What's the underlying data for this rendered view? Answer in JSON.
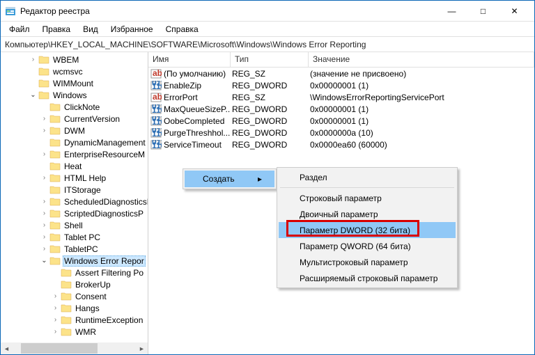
{
  "window": {
    "title": "Редактор реестра",
    "minimize": "—",
    "maximize": "□",
    "close": "✕"
  },
  "menu": {
    "file": "Файл",
    "edit": "Правка",
    "view": "Вид",
    "favorites": "Избранное",
    "help": "Справка"
  },
  "address": {
    "label": "Компьютер",
    "path": "\\HKEY_LOCAL_MACHINE\\SOFTWARE\\Microsoft\\Windows\\Windows Error Reporting"
  },
  "columns": {
    "name": "Имя",
    "type": "Тип",
    "value": "Значение"
  },
  "tree": [
    {
      "pad": 40,
      "toggle": ">",
      "label": "WBEM"
    },
    {
      "pad": 40,
      "toggle": "",
      "label": "wcmsvc"
    },
    {
      "pad": 40,
      "toggle": "",
      "label": "WIMMount"
    },
    {
      "pad": 40,
      "toggle": "v",
      "label": "Windows"
    },
    {
      "pad": 56,
      "toggle": "",
      "label": "ClickNote"
    },
    {
      "pad": 56,
      "toggle": ">",
      "label": "CurrentVersion"
    },
    {
      "pad": 56,
      "toggle": ">",
      "label": "DWM"
    },
    {
      "pad": 56,
      "toggle": "",
      "label": "DynamicManagement"
    },
    {
      "pad": 56,
      "toggle": ">",
      "label": "EnterpriseResourceM"
    },
    {
      "pad": 56,
      "toggle": "",
      "label": "Heat"
    },
    {
      "pad": 56,
      "toggle": ">",
      "label": "HTML Help"
    },
    {
      "pad": 56,
      "toggle": "",
      "label": "ITStorage"
    },
    {
      "pad": 56,
      "toggle": ">",
      "label": "ScheduledDiagnosticsP"
    },
    {
      "pad": 56,
      "toggle": ">",
      "label": "ScriptedDiagnosticsP"
    },
    {
      "pad": 56,
      "toggle": ">",
      "label": "Shell"
    },
    {
      "pad": 56,
      "toggle": ">",
      "label": "Tablet PC"
    },
    {
      "pad": 56,
      "toggle": ">",
      "label": "TabletPC"
    },
    {
      "pad": 56,
      "toggle": "v",
      "label": "Windows Error Repor",
      "selected": true
    },
    {
      "pad": 72,
      "toggle": "",
      "label": "Assert Filtering Po"
    },
    {
      "pad": 72,
      "toggle": "",
      "label": "BrokerUp"
    },
    {
      "pad": 72,
      "toggle": ">",
      "label": "Consent"
    },
    {
      "pad": 72,
      "toggle": ">",
      "label": "Hangs"
    },
    {
      "pad": 72,
      "toggle": ">",
      "label": "RuntimeException"
    },
    {
      "pad": 72,
      "toggle": ">",
      "label": "WMR"
    }
  ],
  "values": [
    {
      "kind": "sz",
      "name": "(По умолчанию)",
      "type": "REG_SZ",
      "value": "(значение не присвоено)"
    },
    {
      "kind": "dw",
      "name": "EnableZip",
      "type": "REG_DWORD",
      "value": "0x00000001 (1)"
    },
    {
      "kind": "sz",
      "name": "ErrorPort",
      "type": "REG_SZ",
      "value": "\\WindowsErrorReportingServicePort"
    },
    {
      "kind": "dw",
      "name": "MaxQueueSizeP...",
      "type": "REG_DWORD",
      "value": "0x00000001 (1)"
    },
    {
      "kind": "dw",
      "name": "OobeCompleted",
      "type": "REG_DWORD",
      "value": "0x00000001 (1)"
    },
    {
      "kind": "dw",
      "name": "PurgeThreshhol...",
      "type": "REG_DWORD",
      "value": "0x0000000a (10)"
    },
    {
      "kind": "dw",
      "name": "ServiceTimeout",
      "type": "REG_DWORD",
      "value": "0x0000ea60 (60000)"
    }
  ],
  "ctx": {
    "create": "Создать",
    "arrow": "▸",
    "section": "Раздел",
    "string": "Строковый параметр",
    "binary": "Двоичный параметр",
    "dword": "Параметр DWORD (32 бита)",
    "qword": "Параметр QWORD (64 бита)",
    "multistring": "Мультистроковый параметр",
    "expandstring": "Расширяемый строковый параметр"
  }
}
